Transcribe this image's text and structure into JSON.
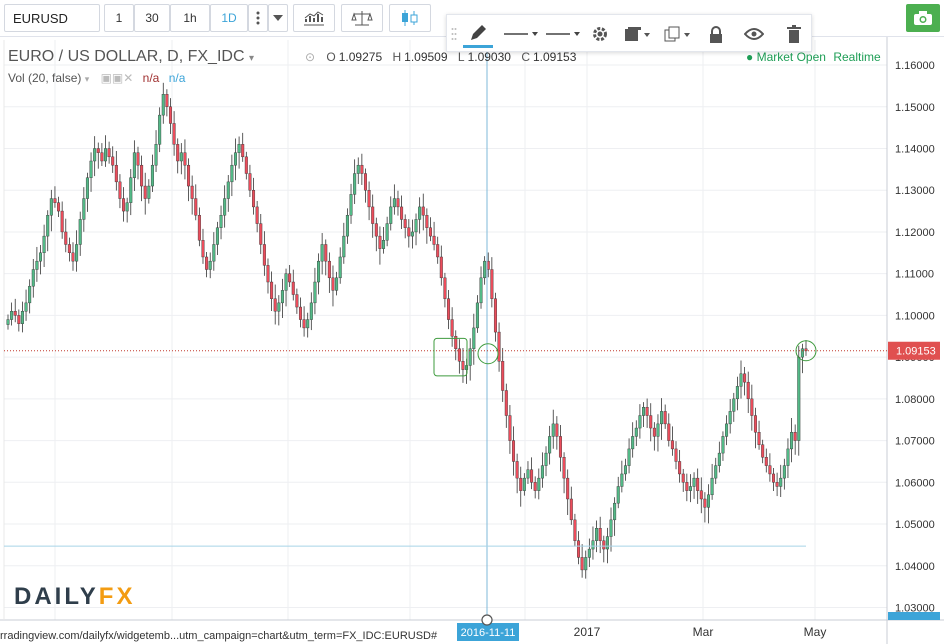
{
  "toolbar": {
    "symbol": "EURUSD",
    "intervals": [
      "1",
      "30",
      "1h",
      "1D"
    ],
    "active_interval": "1D",
    "icons": [
      "more-vert-icon",
      "dropdown-arrow-icon",
      "indicators-icon",
      "compare-icon",
      "candle-style-icon",
      "camera-icon"
    ],
    "accent_color": "#3ca4d8",
    "camera_color": "#4caf50"
  },
  "drawing_toolbar": {
    "icons": [
      "pencil-icon",
      "line-style-icon",
      "line-width-icon",
      "settings-gear-icon",
      "template-icon",
      "clone-icon",
      "lock-icon",
      "eye-icon",
      "trash-icon"
    ]
  },
  "legend": {
    "title": "EURO / US DOLLAR, D, FX_IDC",
    "ohlc": {
      "O": "1.09275",
      "H": "1.09509",
      "L": "1.09030",
      "C": "1.09153"
    },
    "volume": "Vol (20, false)",
    "volume_values": [
      "n/a",
      "n/a"
    ],
    "market_status": "Market Open",
    "realtime": "Realtime"
  },
  "crosshair_label": "2016-11-11",
  "price_label": "1.09153",
  "branding": {
    "logo_main": "DAILY",
    "logo_accent": "FX"
  },
  "url": "rradingview.com/dailyfx/widgetemb...utm_campaign=chart&utm_term=FX_IDC:EURUSD#",
  "chart_data": {
    "type": "candlestick",
    "symbol": "EURUSD",
    "timeframe": "D",
    "colors": {
      "up": "#53b987",
      "down": "#eb4d5c"
    },
    "y_ticks": [
      "1.16000",
      "1.15000",
      "1.14000",
      "1.13000",
      "1.12000",
      "1.11000",
      "1.10000",
      "1.09000",
      "1.08000",
      "1.07000",
      "1.06000",
      "1.05000",
      "1.04000",
      "1.03000"
    ],
    "ylim": [
      1.027,
      1.166
    ],
    "x_ticks": [
      "2017",
      "Mar",
      "May"
    ],
    "last_price": 1.09153,
    "horizontal_line": 1.0447,
    "approx_closes": [
      1.099,
      1.101,
      1.1,
      1.098,
      1.101,
      1.103,
      1.107,
      1.111,
      1.113,
      1.115,
      1.119,
      1.124,
      1.128,
      1.127,
      1.125,
      1.12,
      1.117,
      1.115,
      1.113,
      1.117,
      1.123,
      1.128,
      1.133,
      1.137,
      1.14,
      1.139,
      1.137,
      1.14,
      1.138,
      1.136,
      1.132,
      1.128,
      1.125,
      1.127,
      1.133,
      1.139,
      1.136,
      1.131,
      1.128,
      1.131,
      1.136,
      1.141,
      1.148,
      1.153,
      1.15,
      1.146,
      1.141,
      1.137,
      1.139,
      1.136,
      1.131,
      1.128,
      1.124,
      1.118,
      1.114,
      1.111,
      1.113,
      1.117,
      1.121,
      1.124,
      1.128,
      1.132,
      1.136,
      1.139,
      1.141,
      1.138,
      1.134,
      1.13,
      1.126,
      1.122,
      1.117,
      1.112,
      1.108,
      1.104,
      1.101,
      1.103,
      1.106,
      1.11,
      1.108,
      1.105,
      1.102,
      1.099,
      1.097,
      1.099,
      1.103,
      1.108,
      1.113,
      1.117,
      1.113,
      1.109,
      1.106,
      1.109,
      1.114,
      1.119,
      1.124,
      1.129,
      1.134,
      1.136,
      1.134,
      1.13,
      1.126,
      1.122,
      1.119,
      1.116,
      1.118,
      1.122,
      1.126,
      1.128,
      1.126,
      1.123,
      1.121,
      1.119,
      1.12,
      1.123,
      1.126,
      1.124,
      1.121,
      1.119,
      1.117,
      1.114,
      1.109,
      1.104,
      1.099,
      1.095,
      1.092,
      1.089,
      1.087,
      1.088,
      1.092,
      1.097,
      1.103,
      1.109,
      1.113,
      1.111,
      1.104,
      1.096,
      1.089,
      1.082,
      1.076,
      1.07,
      1.065,
      1.061,
      1.058,
      1.061,
      1.063,
      1.06,
      1.058,
      1.061,
      1.064,
      1.067,
      1.071,
      1.074,
      1.071,
      1.066,
      1.061,
      1.056,
      1.051,
      1.046,
      1.042,
      1.039,
      1.042,
      1.044,
      1.046,
      1.049,
      1.046,
      1.044,
      1.047,
      1.051,
      1.055,
      1.059,
      1.062,
      1.064,
      1.068,
      1.071,
      1.073,
      1.076,
      1.078,
      1.076,
      1.073,
      1.071,
      1.074,
      1.077,
      1.074,
      1.07,
      1.068,
      1.065,
      1.062,
      1.06,
      1.058,
      1.059,
      1.061,
      1.058,
      1.056,
      1.054,
      1.057,
      1.061,
      1.064,
      1.067,
      1.071,
      1.074,
      1.077,
      1.08,
      1.083,
      1.086,
      1.084,
      1.08,
      1.076,
      1.072,
      1.069,
      1.066,
      1.064,
      1.062,
      1.06,
      1.059,
      1.061,
      1.064,
      1.068,
      1.072,
      1.07,
      1.09,
      1.092,
      1.0915
    ]
  }
}
